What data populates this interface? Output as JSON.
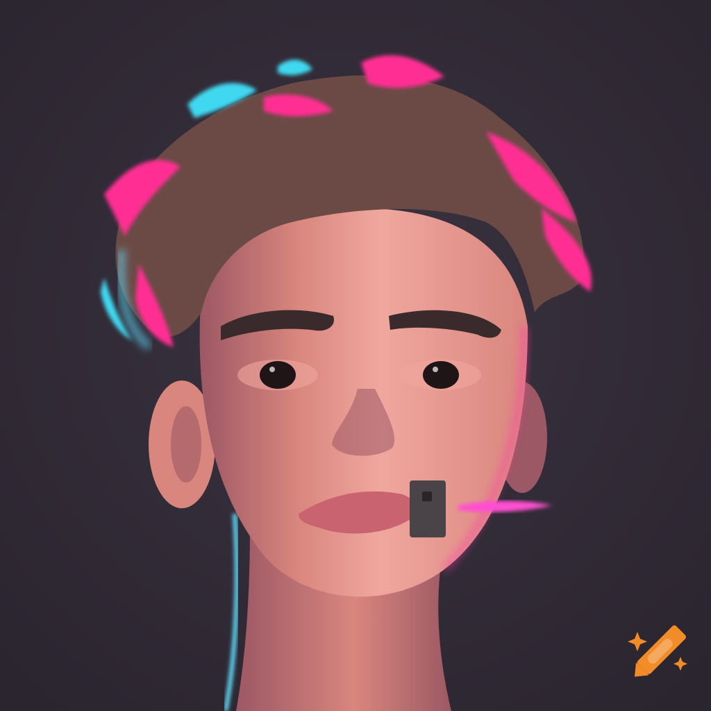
{
  "scene": {
    "subject": "neon-portrait",
    "palette": {
      "background": "#2b2530",
      "background_glow": "#3a3340",
      "hair_pink": "#ff2f93",
      "hair_brown": "#6b4a45",
      "hair_cyan": "#3fd8f0",
      "skin_light": "#f0a79e",
      "skin_mid": "#d9867e",
      "skin_shadow": "#9c5864",
      "rim_cyan": "#5fe0ff",
      "rim_pink": "#ff3aa8",
      "lips": "#c9636f",
      "brows": "#3a2a2c",
      "eye_dark": "#1f1416",
      "device": "#4a4449",
      "neon_streak": "#ff4fd0"
    }
  },
  "watermark": {
    "icon": "crayon-icon",
    "colors": {
      "body": "#f28c28",
      "band": "#ffffff",
      "sparkle": "#f28c28"
    }
  }
}
